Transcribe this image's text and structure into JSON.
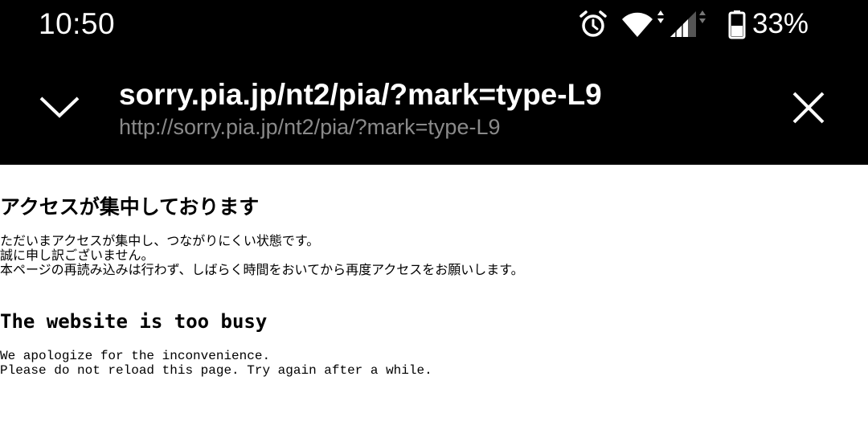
{
  "status_bar": {
    "time": "10:50",
    "battery_percent": "33%",
    "battery_level": 0.33,
    "icons": [
      "alarm-icon",
      "wifi-icon",
      "cell-signal-icon",
      "battery-icon"
    ]
  },
  "toolbar": {
    "title": "sorry.pia.jp/nt2/pia/?mark=type-L9",
    "url": "http://sorry.pia.jp/nt2/pia/?mark=type-L9",
    "icons": [
      "chevron-down-icon",
      "close-icon"
    ]
  },
  "content": {
    "jp_heading": "アクセスが集中しております",
    "jp_lines": [
      "ただいまアクセスが集中し、つながりにくい状態です。",
      "誠に申し訳ございません。",
      "本ページの再読み込みは行わず、しばらく時間をおいてから再度アクセスをお願いします。"
    ],
    "en_heading": "The website is too busy",
    "en_lines": [
      "We apologize for the inconvenience.",
      "Please do not reload this page. Try again after a while."
    ]
  },
  "colors": {
    "bar_background": "#000000",
    "bar_text": "#ffffff",
    "url_text": "#8a8a8a",
    "page_background": "#ffffff"
  }
}
